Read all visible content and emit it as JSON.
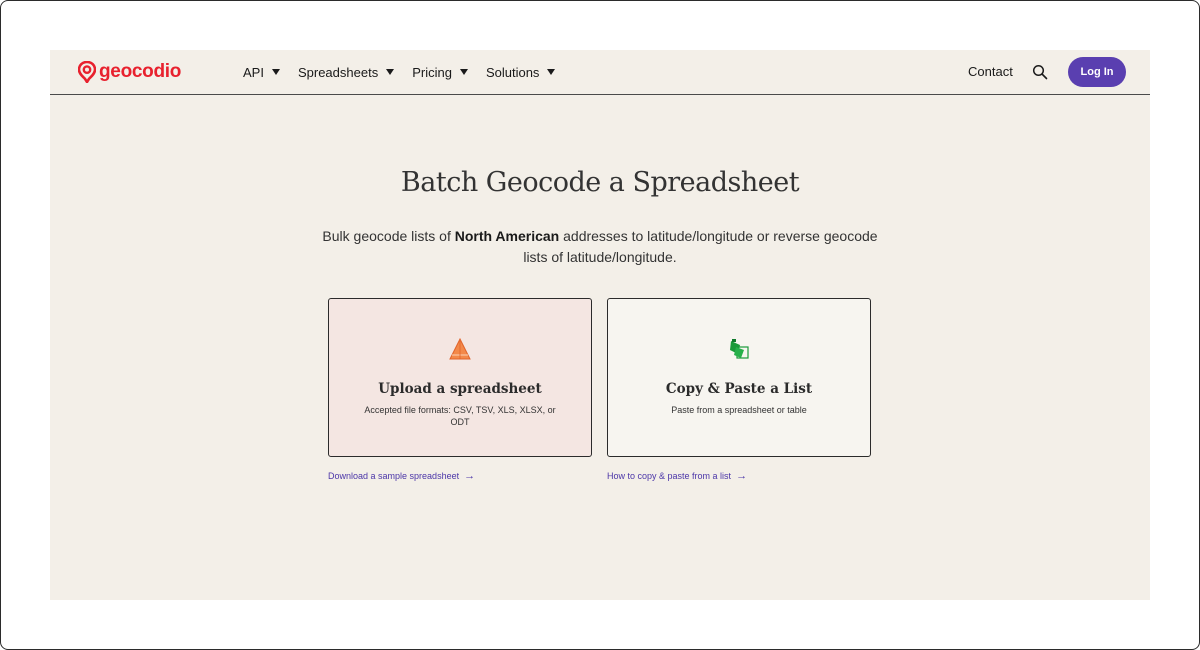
{
  "brand": {
    "name": "geocodio",
    "color": "#e8212e",
    "accent": "#5a3fb0"
  },
  "nav": {
    "items": [
      {
        "label": "API"
      },
      {
        "label": "Spreadsheets"
      },
      {
        "label": "Pricing"
      },
      {
        "label": "Solutions"
      }
    ],
    "contact": "Contact",
    "login": "Log In"
  },
  "hero": {
    "title": "Batch Geocode a Spreadsheet",
    "subtitle_pre": "Bulk geocode lists of ",
    "subtitle_bold": "North American",
    "subtitle_post": " addresses to latitude/longitude or reverse geocode lists of latitude/longitude."
  },
  "cards": {
    "upload": {
      "title": "Upload a spreadsheet",
      "description": "Accepted file formats: CSV, TSV, XLS, XLSX, or ODT",
      "icon": "upload-triangle-icon",
      "link": "Download a sample spreadsheet"
    },
    "paste": {
      "title": "Copy & Paste a List",
      "description": "Paste from a spreadsheet or table",
      "icon": "copy-paste-icon",
      "link": "How to copy & paste from a list"
    }
  },
  "icons": {
    "link_arrow": "→"
  }
}
